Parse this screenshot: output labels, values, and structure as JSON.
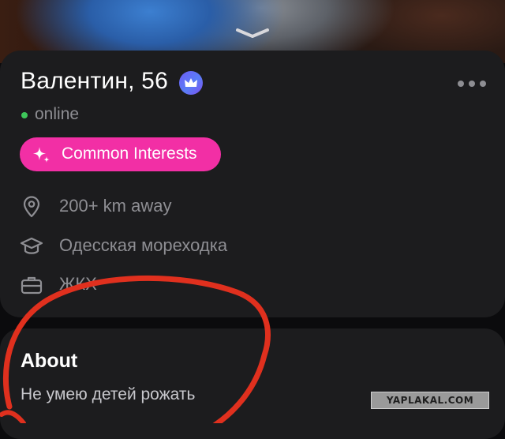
{
  "profile": {
    "name_age": "Валентин, 56",
    "status": "online",
    "interests_label": "Common Interests",
    "distance": "200+ km away",
    "education": "Одесская мореходка",
    "job": "ЖКХ"
  },
  "about": {
    "title": "About",
    "text": "Не умею детей рожать"
  },
  "watermark": "YAPLAKAL.COM",
  "colors": {
    "card_bg": "#1c1c1e",
    "accent_pink": "#f22fa5",
    "online_green": "#3ec75a",
    "secondary_text": "#8e8e93",
    "annotation_red": "#e0301e"
  },
  "icons": [
    "chevron-down-icon",
    "crown-icon",
    "more-icon",
    "sparkle-icon",
    "location-pin-icon",
    "graduation-cap-icon",
    "briefcase-icon"
  ]
}
